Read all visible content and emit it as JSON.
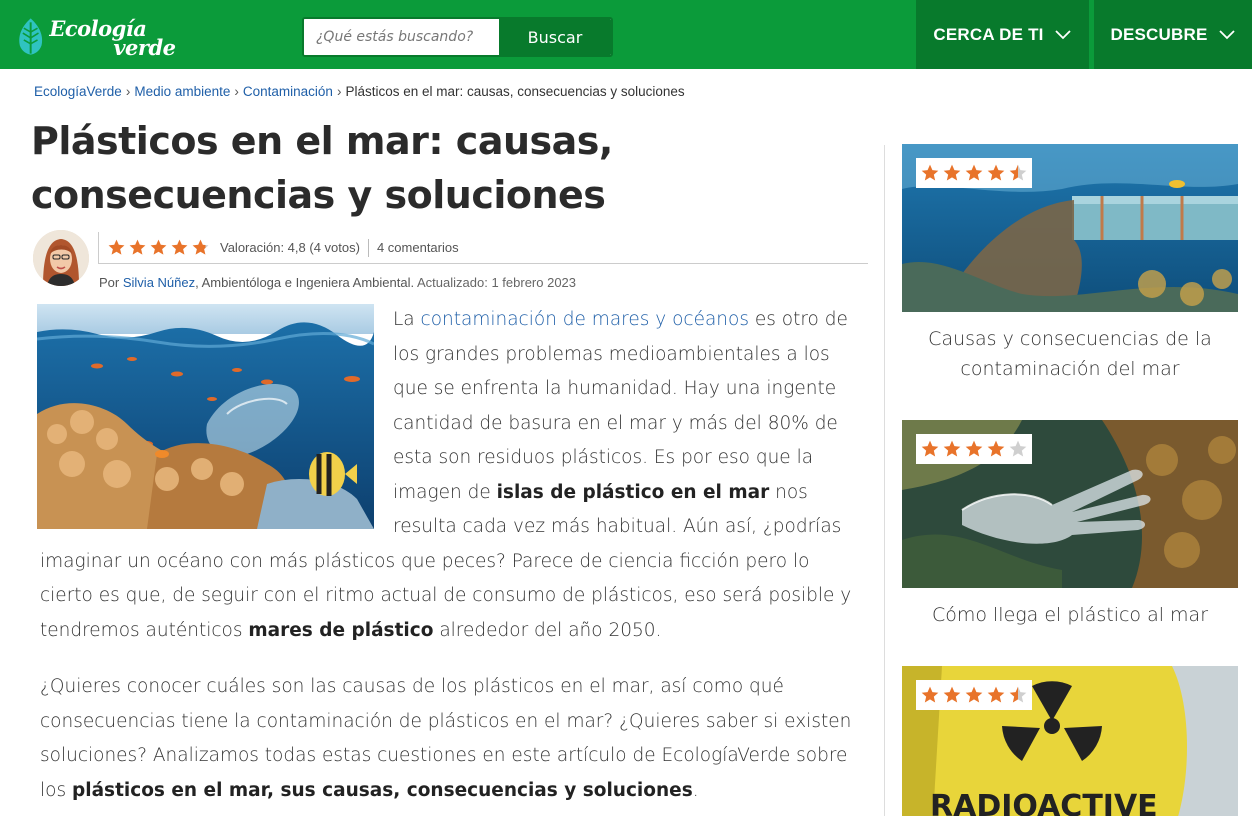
{
  "header": {
    "logo_line1": "Ecología",
    "logo_line2": "verde",
    "search_placeholder": "¿Qué estás buscando?",
    "search_button": "Buscar",
    "nav": [
      {
        "label": "CERCA DE TI",
        "icon": "chevron-down-icon"
      },
      {
        "label": "DESCUBRE",
        "icon": "chevron-down-icon"
      }
    ],
    "colors": {
      "brand_green": "#0b9b3a",
      "dark_green": "#087a2c"
    }
  },
  "breadcrumb": {
    "items": [
      "EcologíaVerde",
      "Medio ambiente",
      "Contaminación"
    ],
    "separator": "›",
    "current": "Plásticos en el mar: causas, consecuencias y soluciones"
  },
  "article": {
    "title": "Plásticos en el mar: causas, consecuencias y soluciones",
    "rating_stars": 4.8,
    "rating_text": "Valoración: 4,8 (4 votos)",
    "comments": "4 comentarios",
    "by_prefix": "Por",
    "author": "Silvia Núñez",
    "author_role": ", Ambientóloga e Ingeniera Ambiental.",
    "updated": "Actualizado: 1 febrero 2023",
    "p1": {
      "t1": "La ",
      "link": "contaminación de mares y océanos",
      "t2": " es otro de los grandes problemas medioambientales a los que se enfrenta la humanidad. Hay una ingente cantidad de basura en el mar y más del 80% de esta son residuos plásticos. Es por eso que la imagen de ",
      "b1": "islas de plástico en el mar",
      "t3": " nos resulta cada vez más habitual. Aún así, ¿podrías imaginar un océano con más plásticos que peces? Parece de ciencia ficción pero lo cierto es que, de seguir con el ritmo actual de consumo de plásticos, eso será posible y tendremos auténticos ",
      "b2": "mares de plástico",
      "t4": " alrededor del año 2050."
    },
    "p2": {
      "t1": "¿Quieres conocer cuáles son las causas de los plásticos en el mar, así como qué consecuencias tiene la contaminación de plásticos en el mar? ¿Quieres saber si existen soluciones? Analizamos todas estas cuestiones en este artículo de EcologíaVerde sobre los ",
      "b1": "plásticos en el mar, sus causas, consecuencias y soluciones",
      "t2": "."
    },
    "link_color": "#1f5fa8",
    "star_color": "#e8732a"
  },
  "sidebar": [
    {
      "title": "Causas y consecuencias de la contaminación del mar",
      "stars": 4.5
    },
    {
      "title": "Cómo llega el plástico al mar",
      "stars": 4
    },
    {
      "title": "",
      "stars": 4.5,
      "image_text": "RADIOACTIVE"
    }
  ]
}
